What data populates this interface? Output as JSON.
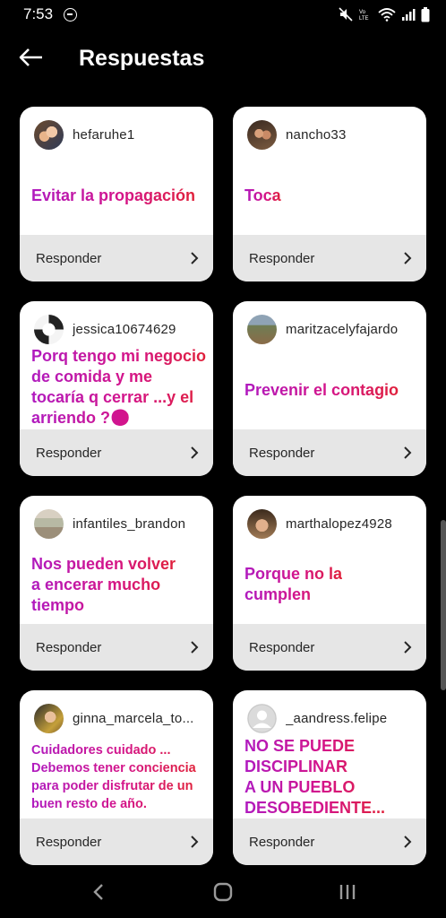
{
  "status": {
    "time": "7:53",
    "icons": [
      "dnd-icon",
      "mute-icon",
      "volte-icon",
      "wifi-icon",
      "signal-icon",
      "battery-icon"
    ]
  },
  "header": {
    "title": "Respuestas",
    "back_icon": "arrow-left-icon"
  },
  "reply_label": "Responder",
  "cards": [
    {
      "username": "hefaruhe1",
      "answer": "Evitar la propagación"
    },
    {
      "username": "nancho33",
      "answer": "Toca"
    },
    {
      "username": "jessica10674629",
      "answer": "Porq tengo mi negocio\nde comida y me\ntocaría q cerrar ...y el\narriendo ?😟"
    },
    {
      "username": "maritzacelyfajardo",
      "answer": "Prevenir el contagio"
    },
    {
      "username": "infantiles_brandon",
      "answer": "Nos pueden volver\na encerar mucho\ntiempo"
    },
    {
      "username": "marthalopez4928",
      "answer": "Porque no la\ncumplen"
    },
    {
      "username": "ginna_marcela_to...",
      "answer": "Cuidadores cuidado ...\nDebemos tener conciencia\npara poder disfrutar de un\nbuen resto de año."
    },
    {
      "username": "_aandress.felipe",
      "answer": "NO SE PUEDE\nDISCIPLINAR\nA UN PUEBLO\nDESOBEDIENTE..."
    }
  ],
  "nav": {
    "back": "nav-back-icon",
    "home": "nav-home-icon",
    "recents": "nav-recents-icon"
  }
}
